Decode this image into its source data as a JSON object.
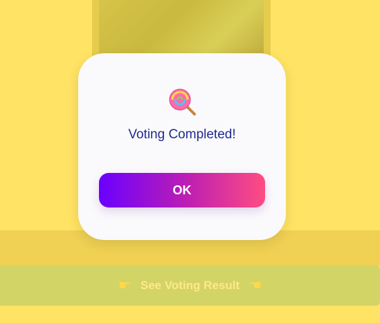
{
  "background": {
    "result_link_label": "See Voting Result",
    "left_hand_icon": "pointing-hand-right",
    "right_hand_icon": "pointing-hand-left"
  },
  "modal": {
    "icon": "lollipop-icon",
    "title": "Voting Completed!",
    "ok_label": "OK"
  },
  "colors": {
    "page_background": "#ffe364",
    "title_text": "#202a8f",
    "button_gradient_start": "#6a00ff",
    "button_gradient_end": "#ff4d82"
  }
}
